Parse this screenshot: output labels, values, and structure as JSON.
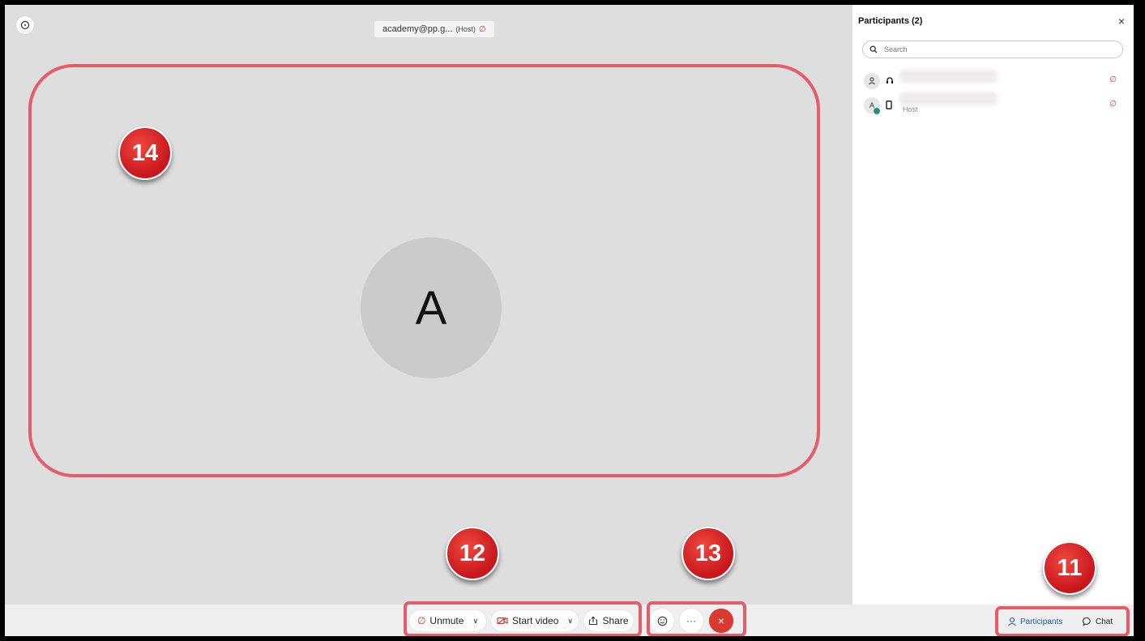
{
  "stage": {
    "meeting_name": "academy@pp.g...",
    "host_label": "(Host)",
    "avatar_initial": "A"
  },
  "badges": {
    "b14": "14",
    "b12": "12",
    "b13": "13",
    "b11": "11"
  },
  "participants_panel": {
    "title": "Participants (2)",
    "close_glyph": "×",
    "search_placeholder": "Search",
    "participants": [
      {
        "avatar": "person-icon",
        "device": "headset-icon",
        "role": ""
      },
      {
        "avatar": "A",
        "device": "phone-icon",
        "role": "Host"
      }
    ]
  },
  "toolbar": {
    "unmute_label": "Unmute",
    "start_video_label": "Start video",
    "share_label": "Share",
    "more_glyph": "···",
    "leave_glyph": "×",
    "participants_tab": "Participants",
    "chat_tab": "Chat"
  },
  "colors": {
    "highlight": "#e35d6a",
    "badge": "#d21d22",
    "leave": "#d9392f",
    "accent": "#1c5ea8"
  }
}
